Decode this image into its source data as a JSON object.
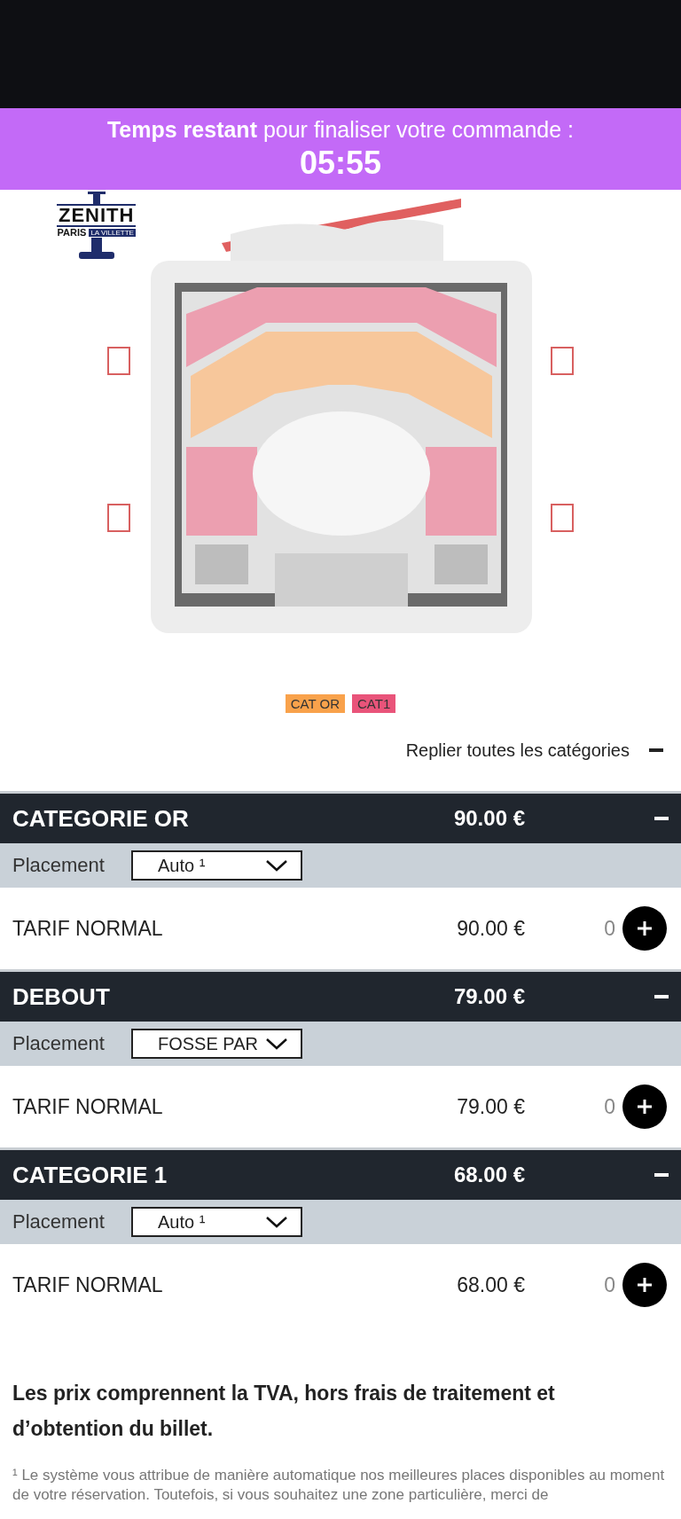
{
  "timer_banner": {
    "message": "**Temps restant** pour finaliser votre commande :",
    "time": "05:55"
  },
  "venue_logo": {
    "title": "ZENITH",
    "city": "PARIS",
    "district": "LA VILLETTE"
  },
  "legend": [
    {
      "label": "CAT OR",
      "color": "#f9a24b"
    },
    {
      "label": "CAT1",
      "color": "#e9547a"
    }
  ],
  "collapse_all": {
    "label": "Replier toutes les catégories",
    "expanded": true
  },
  "categories": [
    {
      "name": "CATEGORIE OR",
      "price": "90.00 €",
      "expanded": true,
      "placement_label": "Placement",
      "placement": "Auto ¹",
      "tariffs": [
        {
          "name": "TARIF NORMAL",
          "price": "90.00 €",
          "quantity": "0"
        }
      ]
    },
    {
      "name": "DEBOUT",
      "price": "79.00 €",
      "expanded": true,
      "placement_label": "Placement",
      "placement": "FOSSE PAR",
      "tariffs": [
        {
          "name": "TARIF NORMAL",
          "price": "79.00 €",
          "quantity": "0"
        }
      ]
    },
    {
      "name": "CATEGORIE 1",
      "price": "68.00 €",
      "expanded": true,
      "placement_label": "Placement",
      "placement": "Auto ¹",
      "tariffs": [
        {
          "name": "TARIF NORMAL",
          "price": "68.00 €",
          "quantity": "0"
        }
      ]
    }
  ],
  "notes": {
    "vat": "Les prix comprennent la TVA, hors frais de traitement et d’obtention du billet.",
    "footnote": "¹ Le système vous attribue de manière automatique nos meilleures places disponibles au moment de votre réservation. Toutefois, si vous souhaitez une zone particulière, merci de"
  }
}
